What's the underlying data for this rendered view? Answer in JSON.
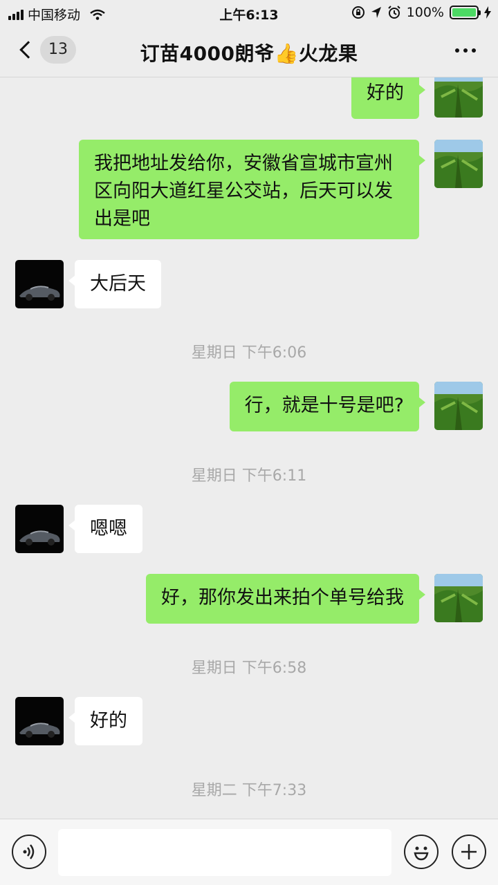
{
  "status_bar": {
    "carrier": "中国移动",
    "time": "上午6:13",
    "battery_text": "100%",
    "battery_level": 1.0
  },
  "header": {
    "back_count": "13",
    "title": "订苗4000朗爷👍火龙果"
  },
  "messages": [
    {
      "sender": "me",
      "text": "好的"
    },
    {
      "sender": "me",
      "text": "我把地址发给你，安徽省宣城市宣州区向阳大道红星公交站，后天可以发出是吧"
    },
    {
      "sender": "them",
      "text": "大后天"
    },
    {
      "timestamp": "星期日 下午6:06"
    },
    {
      "sender": "me",
      "text": "行，就是十号是吧?"
    },
    {
      "timestamp": "星期日 下午6:11"
    },
    {
      "sender": "them",
      "text": "嗯嗯"
    },
    {
      "sender": "me",
      "text": "好，那你发出来拍个单号给我"
    },
    {
      "timestamp": "星期日 下午6:58"
    },
    {
      "sender": "them",
      "text": "好的"
    },
    {
      "timestamp": "星期二 下午7:33"
    }
  ],
  "input_bar": {
    "message_value": "",
    "voice_icon": "voice-icon",
    "emoji_icon": "emoji-icon",
    "plus_icon": "plus-icon"
  },
  "colors": {
    "my_bubble": "#95ec69",
    "their_bubble": "#ffffff",
    "background": "#ededed"
  }
}
